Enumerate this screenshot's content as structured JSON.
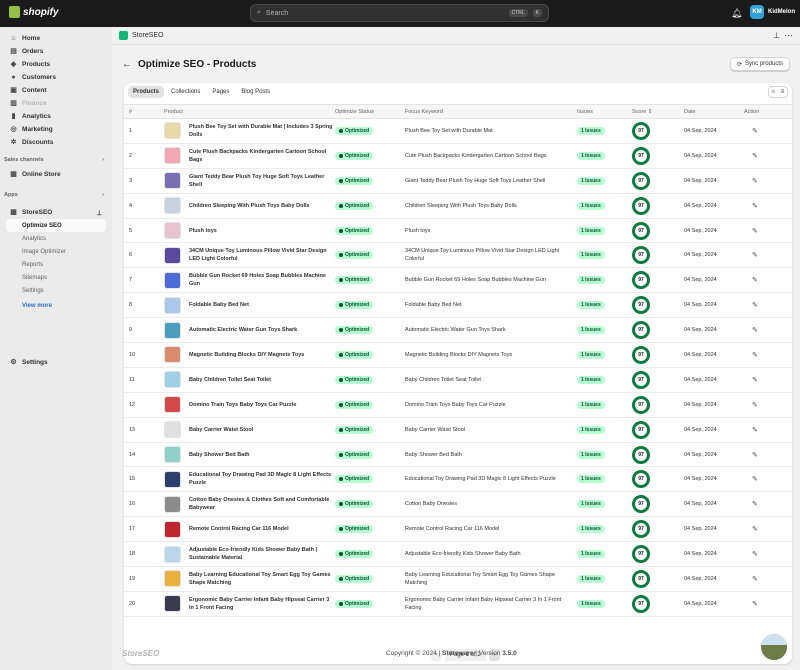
{
  "topbar": {
    "brand": "shopify",
    "search_placeholder": "Search",
    "kbd1": "CTRL",
    "kbd2": "K",
    "store_initials": "KM",
    "store_name": "KidMelon"
  },
  "sidebar": {
    "items": [
      {
        "label": "Home",
        "icon": "home-icon"
      },
      {
        "label": "Orders",
        "icon": "inbox-icon"
      },
      {
        "label": "Products",
        "icon": "tag-icon"
      },
      {
        "label": "Customers",
        "icon": "person-icon"
      },
      {
        "label": "Content",
        "icon": "file-icon"
      },
      {
        "label": "Finance",
        "icon": "bank-icon"
      },
      {
        "label": "Analytics",
        "icon": "chart-icon"
      },
      {
        "label": "Marketing",
        "icon": "target-icon"
      },
      {
        "label": "Discounts",
        "icon": "discount-icon"
      }
    ],
    "sales_channels_label": "Sales channels",
    "online_store": "Online Store",
    "apps_label": "Apps",
    "app_name": "StoreSEO",
    "app_sub": [
      {
        "label": "Optimize SEO"
      },
      {
        "label": "Analytics"
      },
      {
        "label": "Image Optimizer"
      },
      {
        "label": "Reports"
      },
      {
        "label": "Sitemaps"
      },
      {
        "label": "Settings"
      }
    ],
    "view_more": "View more",
    "settings": "Settings"
  },
  "app_header": {
    "name": "StoreSEO"
  },
  "page": {
    "title": "Optimize SEO - Products",
    "sync_button": "Sync products"
  },
  "tabs": [
    "Products",
    "Collections",
    "Pages",
    "Blog Posts"
  ],
  "columns": {
    "num": "#",
    "product": "Product",
    "status": "Optimize Status",
    "keyword": "Focus Keyword",
    "issues": "Issues",
    "score": "Score",
    "date": "Date",
    "action": "Action"
  },
  "rows": [
    {
      "n": "1",
      "name": "Plush Bee Toy Set with Durable Mat | Includes 3 Spring Dolls",
      "kw": "Plush Bee Toy Set with Durable Mat",
      "color": "#e8d9a8"
    },
    {
      "n": "2",
      "name": "Cute Plush Backpacks Kindergarten Cartoon School Bags",
      "kw": "Cute Plush Backpacks Kindergarten Cartoon School Bags",
      "color": "#f2a7b5"
    },
    {
      "n": "3",
      "name": "Giant Teddy Bear Plush Toy Huge Soft Toys Leather Shell",
      "kw": "Giant Teddy Bear Plush Toy Huge Soft Toys Leather Shell",
      "color": "#7b6fb3"
    },
    {
      "n": "4",
      "name": "Children Sleeping With Plush Toys Baby Dolls",
      "kw": "Children Sleeping With Plush Toys Baby Dolls",
      "color": "#c9d3dd"
    },
    {
      "n": "5",
      "name": "Plush toys",
      "kw": "Plush toys",
      "color": "#e7c3cf"
    },
    {
      "n": "6",
      "name": "34CM Unique Toy Luminous Pillow Vivid Star Design LED Light Colorful",
      "kw": "34CM Unique Toy Luminous Pillow Vivid Star Design LED Light Colorful",
      "color": "#5a4a9e"
    },
    {
      "n": "7",
      "name": "Bubble Gun Rocket 69 Holes Soap Bubbles Machine Gun",
      "kw": "Bubble Gun Rocket 69 Holes Soap Bubbles Machine Gun",
      "color": "#4f6bd6"
    },
    {
      "n": "8",
      "name": "Foldable Baby Bed Net",
      "kw": "Foldable Baby Bed Net",
      "color": "#a9c8ea"
    },
    {
      "n": "9",
      "name": "Automatic Electric Water Gun Toys Shark",
      "kw": "Automatic Electric Water Gun Toys Shark",
      "color": "#4d9dc1"
    },
    {
      "n": "10",
      "name": "Magnetic Building Blocks DIY Magnets Toys",
      "kw": "Magnetic Building Blocks DIY Magnets Toys",
      "color": "#d98c6c"
    },
    {
      "n": "11",
      "name": "Baby Children Toilet Seat Toilet",
      "kw": "Baby Children Toilet Seat Toilet",
      "color": "#9fd0e6"
    },
    {
      "n": "12",
      "name": "Domino Train Toys Baby Toys Car Puzzle",
      "kw": "Domino Train Toys Baby Toys Car Puzzle",
      "color": "#d44a4a"
    },
    {
      "n": "13",
      "name": "Baby Carrier Waist Stool",
      "kw": "Baby Carrier Waist Stool",
      "color": "#e0e0e0"
    },
    {
      "n": "14",
      "name": "Baby Shower Bed Bath",
      "kw": "Baby Shower Bed Bath",
      "color": "#8fd1c6"
    },
    {
      "n": "15",
      "name": "Educational Toy Drawing Pad 3D Magic 8 Light Effects Puzzle",
      "kw": "Educational Toy Drawing Pad 3D Magic 8 Light Effects Puzzle",
      "color": "#2e3f6e"
    },
    {
      "n": "16",
      "name": "Cotton Baby Onesies & Clothes Soft and Comfortable Babywear",
      "kw": "Cotton Baby Onesies",
      "color": "#8c8c8c"
    },
    {
      "n": "17",
      "name": "Remote Control Racing Car 116 Model",
      "kw": "Remote Control Racing Car 116 Model",
      "color": "#c0262d"
    },
    {
      "n": "18",
      "name": "Adjustable Eco-friendly Kids Shower Baby Bath | Sustainable Material",
      "kw": "Adjustable Eco-friendly Kids Shower Baby Bath",
      "color": "#b9d7e8"
    },
    {
      "n": "19",
      "name": "Baby Learning Educational Toy Smart Egg Toy Games Shape Matching",
      "kw": "Baby Learning Educational Toy Smart Egg Toy Games Shape Matching",
      "color": "#e7b13c"
    },
    {
      "n": "20",
      "name": "Ergonomic Baby Carrier Infant Baby Hipseat Carrier 3 In 1 Front Facing",
      "kw": "Ergonomic Baby Carrier Infant Baby Hipseat Carrier 3 In 1 Front Facing",
      "color": "#3b3b4f"
    }
  ],
  "row_common": {
    "status": "Optimized",
    "issues": "1 Issues",
    "score": "97",
    "date": "04 Sep, 2024"
  },
  "pager": {
    "label": "Page 1 of 2"
  },
  "footer": {
    "logo": "StoreSEO",
    "copyright": "Copyright © 2024 |",
    "company": "Storeware",
    "version_label": "| Version",
    "version": "3.5.0"
  },
  "colors": {
    "accent_green": "#15b679",
    "optimized_bg": "#b4fed2",
    "score_ring": "#0f7a3f",
    "link": "#2c6ecb"
  }
}
